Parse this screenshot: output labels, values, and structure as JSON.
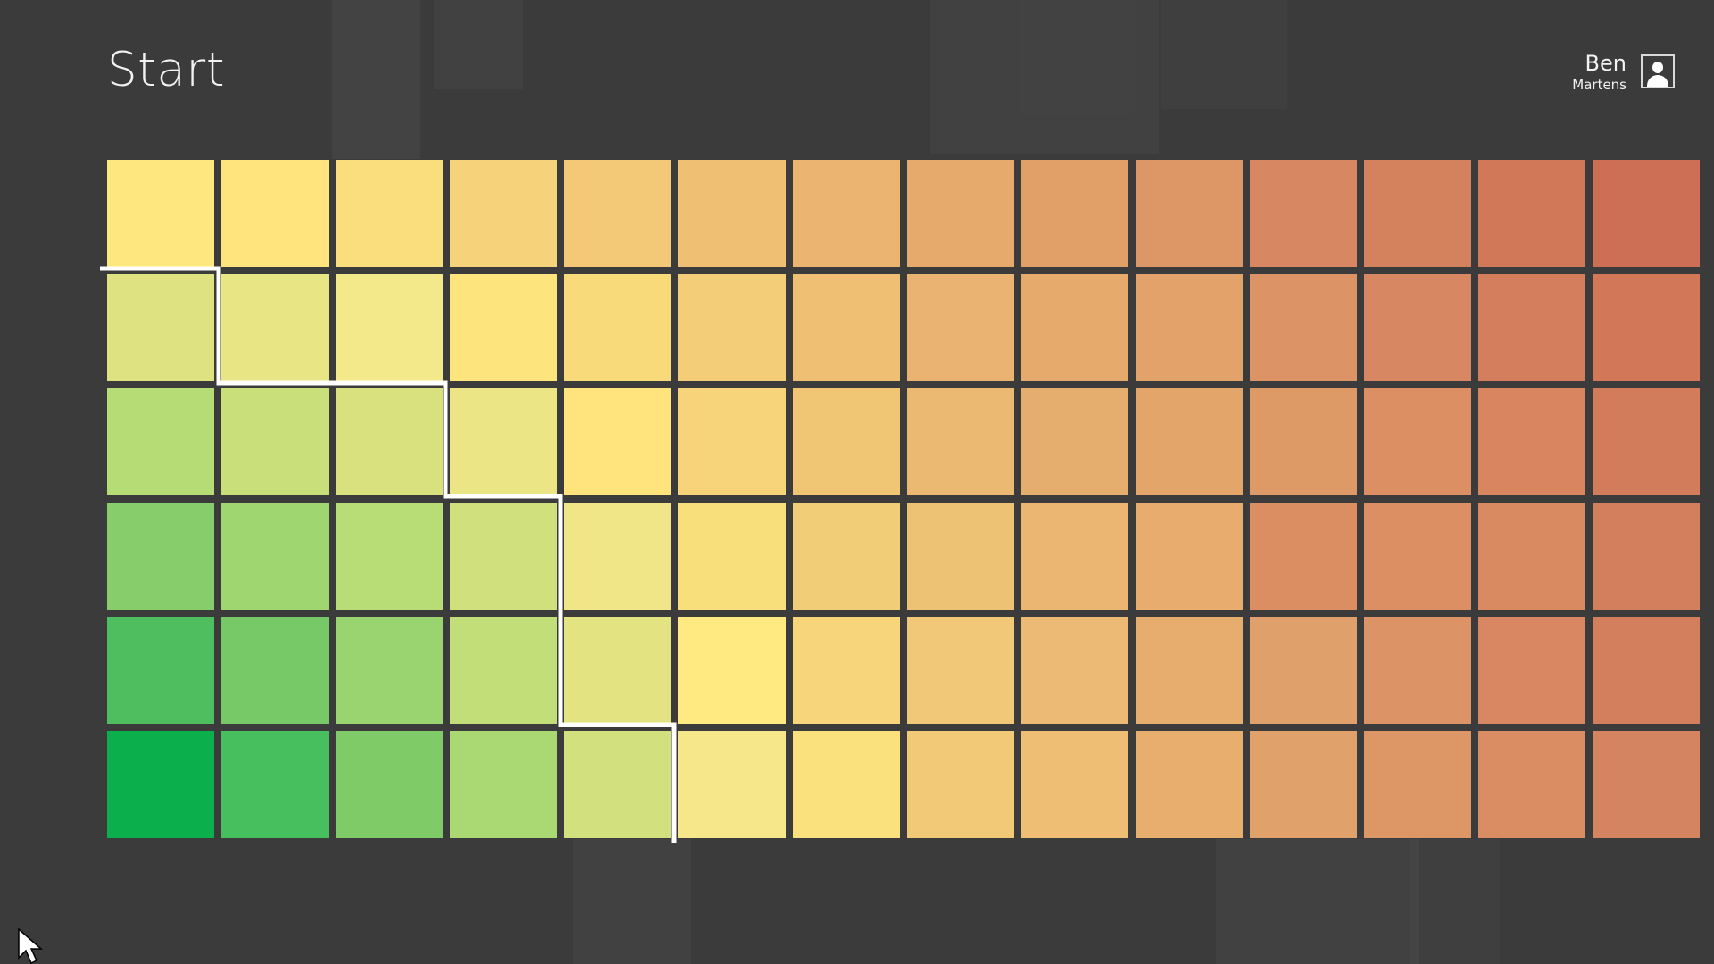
{
  "header": {
    "title": "Start"
  },
  "user": {
    "first_name": "Ben",
    "last_name": "Martens",
    "avatar_icon": "user-silhouette-icon"
  },
  "tiles": {
    "rows": 6,
    "columns": 14,
    "colors": [
      [
        "#ffe780",
        "#ffe47e",
        "#fadd7c",
        "#f6d27a",
        "#f3c877",
        "#efbf74",
        "#ebb470",
        "#e6aa6c",
        "#e2a069",
        "#dd9665",
        "#d78761",
        "#d4815e",
        "#d17859",
        "#cc6f55"
      ],
      [
        "#dee281",
        "#e8e585",
        "#f4e98a",
        "#fee47d",
        "#f8da7b",
        "#f3cd78",
        "#efbf74",
        "#eab372",
        "#e6aa6c",
        "#e3a26a",
        "#dc9466",
        "#d78761",
        "#d47e5d",
        "#d27858"
      ],
      [
        "#b5dc75",
        "#c9e07a",
        "#d9e17e",
        "#ebe586",
        "#ffe47e",
        "#f7d47a",
        "#f0c574",
        "#ecb972",
        "#e6ae6e",
        "#e4a56b",
        "#de9a66",
        "#db8f63",
        "#d98660",
        "#d27c5b"
      ],
      [
        "#87cd6b",
        "#a0d66f",
        "#b8dd76",
        "#d0e07d",
        "#f0e687",
        "#f9df7c",
        "#f2cd78",
        "#eec274",
        "#eab672",
        "#e8ac6e",
        "#db8e62",
        "#dc8f63",
        "#da8a60",
        "#d37f5d"
      ],
      [
        "#4ebe5f",
        "#76c966",
        "#9ad471",
        "#c2de79",
        "#e3e381",
        "#ffe980",
        "#f6d57b",
        "#f1c778",
        "#ecba74",
        "#e6ad6f",
        "#e0a06b",
        "#dc9466",
        "#d98762",
        "#d37f5d"
      ],
      [
        "#0bb04d",
        "#48bf5e",
        "#7ecb68",
        "#aad872",
        "#d2e07d",
        "#f6e88a",
        "#fbe17d",
        "#f2c977",
        "#eebe74",
        "#e7ae6e",
        "#e0a16b",
        "#dd9666",
        "#da8c62",
        "#d48460"
      ]
    ]
  },
  "boundary_line_color": "#ffffff",
  "background_color": "#3b3b3b",
  "cursor_icon": "mouse-pointer-icon"
}
